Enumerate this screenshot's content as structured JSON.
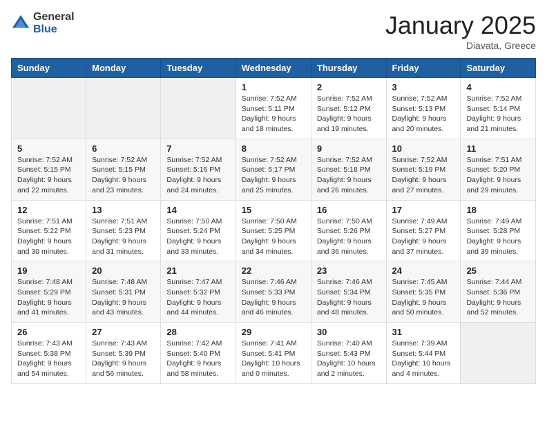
{
  "header": {
    "logo_general": "General",
    "logo_blue": "Blue",
    "month_title": "January 2025",
    "location": "Diavata, Greece"
  },
  "weekdays": [
    "Sunday",
    "Monday",
    "Tuesday",
    "Wednesday",
    "Thursday",
    "Friday",
    "Saturday"
  ],
  "weeks": [
    [
      {
        "day": "",
        "info": ""
      },
      {
        "day": "",
        "info": ""
      },
      {
        "day": "",
        "info": ""
      },
      {
        "day": "1",
        "info": "Sunrise: 7:52 AM\nSunset: 5:11 PM\nDaylight: 9 hours\nand 18 minutes."
      },
      {
        "day": "2",
        "info": "Sunrise: 7:52 AM\nSunset: 5:12 PM\nDaylight: 9 hours\nand 19 minutes."
      },
      {
        "day": "3",
        "info": "Sunrise: 7:52 AM\nSunset: 5:13 PM\nDaylight: 9 hours\nand 20 minutes."
      },
      {
        "day": "4",
        "info": "Sunrise: 7:52 AM\nSunset: 5:14 PM\nDaylight: 9 hours\nand 21 minutes."
      }
    ],
    [
      {
        "day": "5",
        "info": "Sunrise: 7:52 AM\nSunset: 5:15 PM\nDaylight: 9 hours\nand 22 minutes."
      },
      {
        "day": "6",
        "info": "Sunrise: 7:52 AM\nSunset: 5:15 PM\nDaylight: 9 hours\nand 23 minutes."
      },
      {
        "day": "7",
        "info": "Sunrise: 7:52 AM\nSunset: 5:16 PM\nDaylight: 9 hours\nand 24 minutes."
      },
      {
        "day": "8",
        "info": "Sunrise: 7:52 AM\nSunset: 5:17 PM\nDaylight: 9 hours\nand 25 minutes."
      },
      {
        "day": "9",
        "info": "Sunrise: 7:52 AM\nSunset: 5:18 PM\nDaylight: 9 hours\nand 26 minutes."
      },
      {
        "day": "10",
        "info": "Sunrise: 7:52 AM\nSunset: 5:19 PM\nDaylight: 9 hours\nand 27 minutes."
      },
      {
        "day": "11",
        "info": "Sunrise: 7:51 AM\nSunset: 5:20 PM\nDaylight: 9 hours\nand 29 minutes."
      }
    ],
    [
      {
        "day": "12",
        "info": "Sunrise: 7:51 AM\nSunset: 5:22 PM\nDaylight: 9 hours\nand 30 minutes."
      },
      {
        "day": "13",
        "info": "Sunrise: 7:51 AM\nSunset: 5:23 PM\nDaylight: 9 hours\nand 31 minutes."
      },
      {
        "day": "14",
        "info": "Sunrise: 7:50 AM\nSunset: 5:24 PM\nDaylight: 9 hours\nand 33 minutes."
      },
      {
        "day": "15",
        "info": "Sunrise: 7:50 AM\nSunset: 5:25 PM\nDaylight: 9 hours\nand 34 minutes."
      },
      {
        "day": "16",
        "info": "Sunrise: 7:50 AM\nSunset: 5:26 PM\nDaylight: 9 hours\nand 36 minutes."
      },
      {
        "day": "17",
        "info": "Sunrise: 7:49 AM\nSunset: 5:27 PM\nDaylight: 9 hours\nand 37 minutes."
      },
      {
        "day": "18",
        "info": "Sunrise: 7:49 AM\nSunset: 5:28 PM\nDaylight: 9 hours\nand 39 minutes."
      }
    ],
    [
      {
        "day": "19",
        "info": "Sunrise: 7:48 AM\nSunset: 5:29 PM\nDaylight: 9 hours\nand 41 minutes."
      },
      {
        "day": "20",
        "info": "Sunrise: 7:48 AM\nSunset: 5:31 PM\nDaylight: 9 hours\nand 43 minutes."
      },
      {
        "day": "21",
        "info": "Sunrise: 7:47 AM\nSunset: 5:32 PM\nDaylight: 9 hours\nand 44 minutes."
      },
      {
        "day": "22",
        "info": "Sunrise: 7:46 AM\nSunset: 5:33 PM\nDaylight: 9 hours\nand 46 minutes."
      },
      {
        "day": "23",
        "info": "Sunrise: 7:46 AM\nSunset: 5:34 PM\nDaylight: 9 hours\nand 48 minutes."
      },
      {
        "day": "24",
        "info": "Sunrise: 7:45 AM\nSunset: 5:35 PM\nDaylight: 9 hours\nand 50 minutes."
      },
      {
        "day": "25",
        "info": "Sunrise: 7:44 AM\nSunset: 5:36 PM\nDaylight: 9 hours\nand 52 minutes."
      }
    ],
    [
      {
        "day": "26",
        "info": "Sunrise: 7:43 AM\nSunset: 5:38 PM\nDaylight: 9 hours\nand 54 minutes."
      },
      {
        "day": "27",
        "info": "Sunrise: 7:43 AM\nSunset: 5:39 PM\nDaylight: 9 hours\nand 56 minutes."
      },
      {
        "day": "28",
        "info": "Sunrise: 7:42 AM\nSunset: 5:40 PM\nDaylight: 9 hours\nand 58 minutes."
      },
      {
        "day": "29",
        "info": "Sunrise: 7:41 AM\nSunset: 5:41 PM\nDaylight: 10 hours\nand 0 minutes."
      },
      {
        "day": "30",
        "info": "Sunrise: 7:40 AM\nSunset: 5:43 PM\nDaylight: 10 hours\nand 2 minutes."
      },
      {
        "day": "31",
        "info": "Sunrise: 7:39 AM\nSunset: 5:44 PM\nDaylight: 10 hours\nand 4 minutes."
      },
      {
        "day": "",
        "info": ""
      }
    ]
  ]
}
